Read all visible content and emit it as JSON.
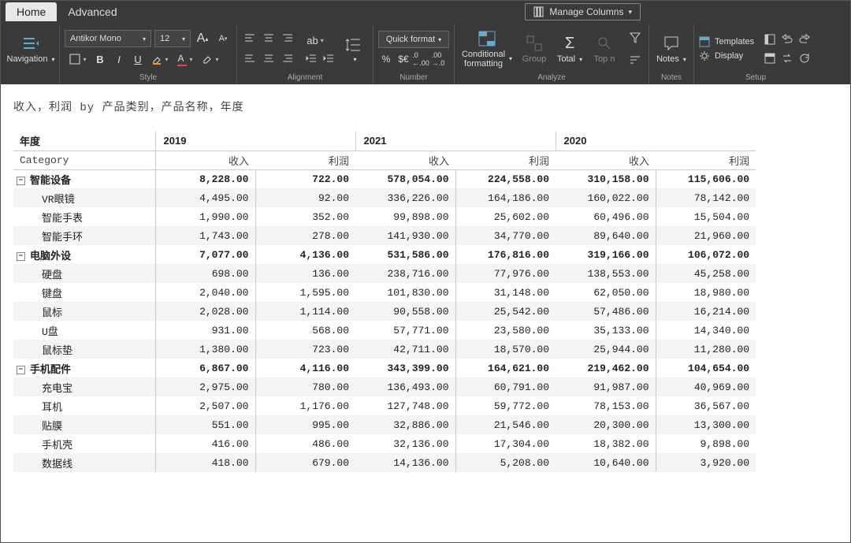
{
  "tabs": {
    "home": "Home",
    "advanced": "Advanced"
  },
  "manage_columns": "Manage Columns",
  "ribbon": {
    "navigation": "Navigation",
    "style_group": "Style",
    "font_name": "Antikor Mono",
    "font_size": "12",
    "alignment_group": "Alignment",
    "ab_label": "ab",
    "number_group": "Number",
    "quick_format": "Quick format",
    "percent": "%",
    "currency": "$€",
    "decimal_inc": ".0←",
    "decimal_dec": ".00→",
    "analyze_group": "Analyze",
    "conditional_formatting": "Conditional\nformatting",
    "group": "Group",
    "total": "Total",
    "top_n": "Top n",
    "notes_group": "Notes",
    "notes": "Notes",
    "setup_group": "Setup",
    "templates": "Templates",
    "display": "Display"
  },
  "title": "收入，利润 by 产品类别，产品名称，年度",
  "header": {
    "year_label": "年度",
    "category_label": "Category",
    "income": "收入",
    "profit": "利润"
  },
  "years": [
    "2019",
    "2021",
    "2020"
  ],
  "groups": [
    {
      "name": "智能设备",
      "totals": [
        "8,228.00",
        "722.00",
        "578,054.00",
        "224,558.00",
        "310,158.00",
        "115,606.00"
      ],
      "rows": [
        {
          "name": "VR眼镜",
          "vals": [
            "4,495.00",
            "92.00",
            "336,226.00",
            "164,186.00",
            "160,022.00",
            "78,142.00"
          ]
        },
        {
          "name": "智能手表",
          "vals": [
            "1,990.00",
            "352.00",
            "99,898.00",
            "25,602.00",
            "60,496.00",
            "15,504.00"
          ]
        },
        {
          "name": "智能手环",
          "vals": [
            "1,743.00",
            "278.00",
            "141,930.00",
            "34,770.00",
            "89,640.00",
            "21,960.00"
          ]
        }
      ]
    },
    {
      "name": "电脑外设",
      "totals": [
        "7,077.00",
        "4,136.00",
        "531,586.00",
        "176,816.00",
        "319,166.00",
        "106,072.00"
      ],
      "rows": [
        {
          "name": "硬盘",
          "vals": [
            "698.00",
            "136.00",
            "238,716.00",
            "77,976.00",
            "138,553.00",
            "45,258.00"
          ]
        },
        {
          "name": "键盘",
          "vals": [
            "2,040.00",
            "1,595.00",
            "101,830.00",
            "31,148.00",
            "62,050.00",
            "18,980.00"
          ]
        },
        {
          "name": "鼠标",
          "vals": [
            "2,028.00",
            "1,114.00",
            "90,558.00",
            "25,542.00",
            "57,486.00",
            "16,214.00"
          ]
        },
        {
          "name": "U盘",
          "vals": [
            "931.00",
            "568.00",
            "57,771.00",
            "23,580.00",
            "35,133.00",
            "14,340.00"
          ]
        },
        {
          "name": "鼠标垫",
          "vals": [
            "1,380.00",
            "723.00",
            "42,711.00",
            "18,570.00",
            "25,944.00",
            "11,280.00"
          ]
        }
      ]
    },
    {
      "name": "手机配件",
      "totals": [
        "6,867.00",
        "4,116.00",
        "343,399.00",
        "164,621.00",
        "219,462.00",
        "104,654.00"
      ],
      "rows": [
        {
          "name": "充电宝",
          "vals": [
            "2,975.00",
            "780.00",
            "136,493.00",
            "60,791.00",
            "91,987.00",
            "40,969.00"
          ]
        },
        {
          "name": "耳机",
          "vals": [
            "2,507.00",
            "1,176.00",
            "127,748.00",
            "59,772.00",
            "78,153.00",
            "36,567.00"
          ]
        },
        {
          "name": "贴膜",
          "vals": [
            "551.00",
            "995.00",
            "32,886.00",
            "21,546.00",
            "20,300.00",
            "13,300.00"
          ]
        },
        {
          "name": "手机壳",
          "vals": [
            "416.00",
            "486.00",
            "32,136.00",
            "17,304.00",
            "18,382.00",
            "9,898.00"
          ]
        },
        {
          "name": "数据线",
          "vals": [
            "418.00",
            "679.00",
            "14,136.00",
            "5,208.00",
            "10,640.00",
            "3,920.00"
          ]
        }
      ]
    }
  ]
}
